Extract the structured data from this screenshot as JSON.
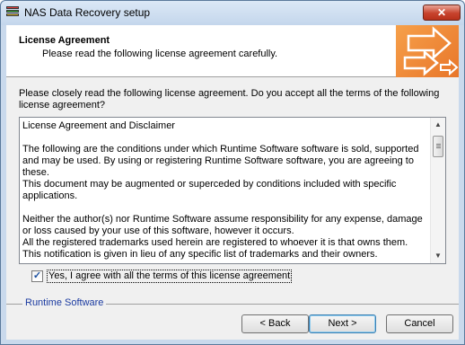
{
  "window": {
    "title": "NAS Data Recovery setup",
    "close_label": "✕"
  },
  "header": {
    "title": "License Agreement",
    "subtitle": "Please read the following license agreement carefully."
  },
  "intro": "Please closely read the following license agreement. Do you accept all the terms of the following license agreement?",
  "license": {
    "text": "License Agreement and Disclaimer\n\nThe following are the conditions under which Runtime Software software is sold, supported and may be used. By using or registering Runtime Software software, you are agreeing to these.\nThis document may be augmented or superceded by conditions included with specific applications.\n\nNeither the author(s) nor Runtime Software assume responsibility for any expense, damage or loss caused by your use of this software, however it occurs.\nAll the registered trademarks used herein are registered to whoever it is that owns them. This notification is given in lieu of any specific list of trademarks and their owners."
  },
  "agree": {
    "checked": true,
    "label": "Yes, I agree with all the terms of this license agreement"
  },
  "footer": {
    "brand": "Runtime Software"
  },
  "buttons": {
    "back": "< Back",
    "next": "Next >",
    "cancel": "Cancel"
  },
  "icons": [
    "app-icon",
    "close-icon",
    "arrows-logo-icon",
    "scroll-up-icon",
    "scroll-down-icon",
    "checkmark-icon"
  ],
  "colors": {
    "header_graphic": "#e8762a",
    "brand_text": "#1a3aa0",
    "close_button": "#c7432d"
  }
}
